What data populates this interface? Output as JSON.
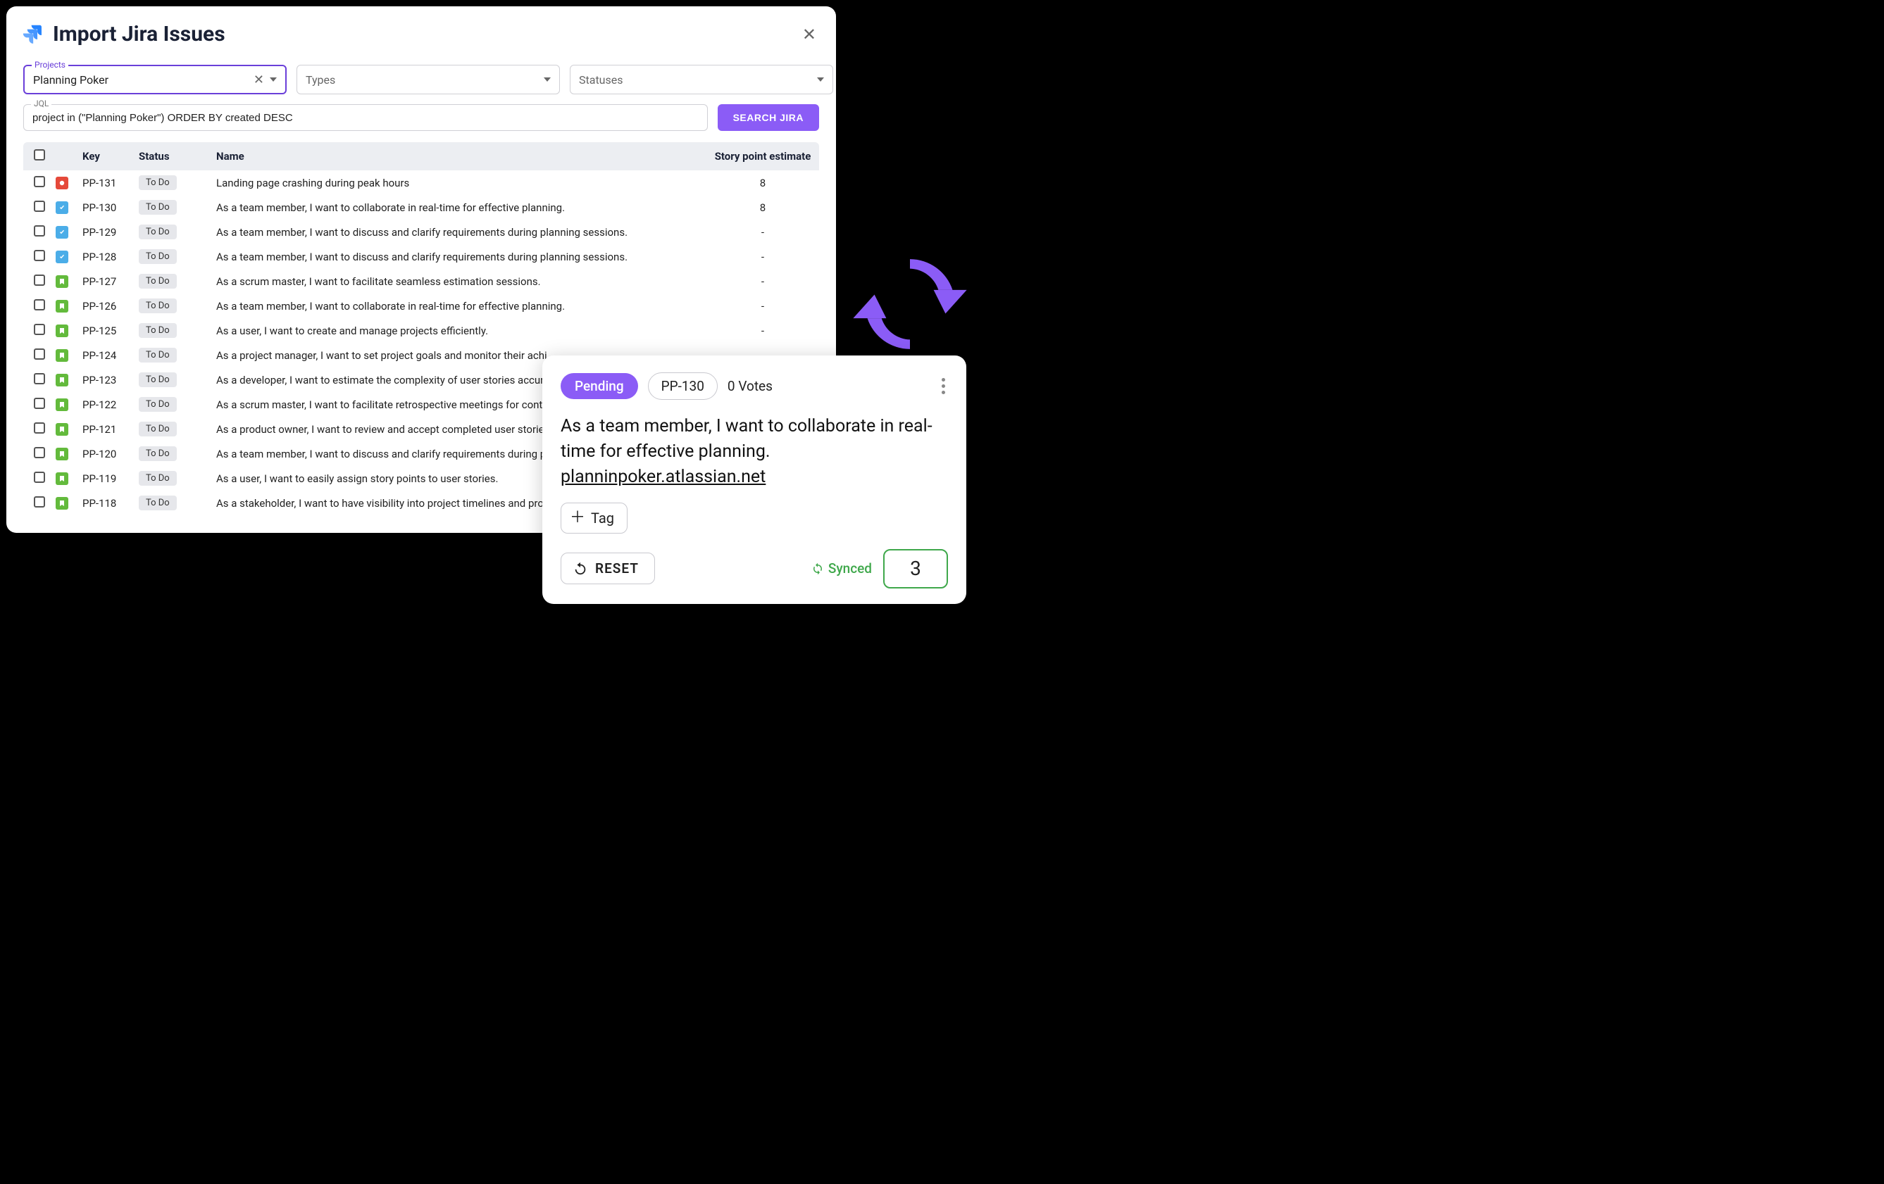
{
  "modal": {
    "title": "Import Jira Issues",
    "filters": {
      "projects_label": "Projects",
      "projects_value": "Planning Poker",
      "types_placeholder": "Types",
      "statuses_placeholder": "Statuses"
    },
    "jql": {
      "label": "JQL",
      "value": "project in (\"Planning Poker\") ORDER BY created DESC"
    },
    "search_button": "SEARCH JIRA",
    "columns": {
      "key": "Key",
      "status": "Status",
      "name": "Name",
      "estimate": "Story point estimate"
    },
    "issues": [
      {
        "type": "bug",
        "key": "PP-131",
        "status": "To Do",
        "name": "Landing page crashing during peak hours",
        "estimate": "8"
      },
      {
        "type": "task",
        "key": "PP-130",
        "status": "To Do",
        "name": "As a team member, I want to collaborate in real-time for effective planning.",
        "estimate": "8"
      },
      {
        "type": "task",
        "key": "PP-129",
        "status": "To Do",
        "name": "As a team member, I want to discuss and clarify requirements during planning sessions.",
        "estimate": "-"
      },
      {
        "type": "task",
        "key": "PP-128",
        "status": "To Do",
        "name": "As a team member, I want to discuss and clarify requirements during planning sessions.",
        "estimate": "-"
      },
      {
        "type": "story",
        "key": "PP-127",
        "status": "To Do",
        "name": "As a scrum master, I want to facilitate seamless estimation sessions.",
        "estimate": "-"
      },
      {
        "type": "story",
        "key": "PP-126",
        "status": "To Do",
        "name": "As a team member, I want to collaborate in real-time for effective planning.",
        "estimate": "-"
      },
      {
        "type": "story",
        "key": "PP-125",
        "status": "To Do",
        "name": "As a user, I want to create and manage projects efficiently.",
        "estimate": "-"
      },
      {
        "type": "story",
        "key": "PP-124",
        "status": "To Do",
        "name": "As a project manager, I want to set project goals and monitor their achi",
        "estimate": ""
      },
      {
        "type": "story",
        "key": "PP-123",
        "status": "To Do",
        "name": "As a developer, I want to estimate the complexity of user stories accura",
        "estimate": ""
      },
      {
        "type": "story",
        "key": "PP-122",
        "status": "To Do",
        "name": "As a scrum master, I want to facilitate retrospective meetings for contin",
        "estimate": ""
      },
      {
        "type": "story",
        "key": "PP-121",
        "status": "To Do",
        "name": "As a product owner, I want to review and accept completed user stories",
        "estimate": ""
      },
      {
        "type": "story",
        "key": "PP-120",
        "status": "To Do",
        "name": "As a team member, I want to discuss and clarify requirements during p",
        "estimate": ""
      },
      {
        "type": "story",
        "key": "PP-119",
        "status": "To Do",
        "name": "As a user, I want to easily assign story points to user stories.",
        "estimate": ""
      },
      {
        "type": "story",
        "key": "PP-118",
        "status": "To Do",
        "name": "As a stakeholder, I want to have visibility into project timelines and prog",
        "estimate": ""
      }
    ]
  },
  "card": {
    "pending": "Pending",
    "key": "PP-130",
    "votes": "0 Votes",
    "story": "As a team member, I want to collaborate in real-time for effective planning.",
    "link": "planninpoker.atlassian.net",
    "tag_label": "Tag",
    "reset_label": "RESET",
    "synced_label": "Synced",
    "estimate": "3"
  },
  "colors": {
    "accent": "#8b5cf6",
    "synced": "#3fa84b"
  }
}
